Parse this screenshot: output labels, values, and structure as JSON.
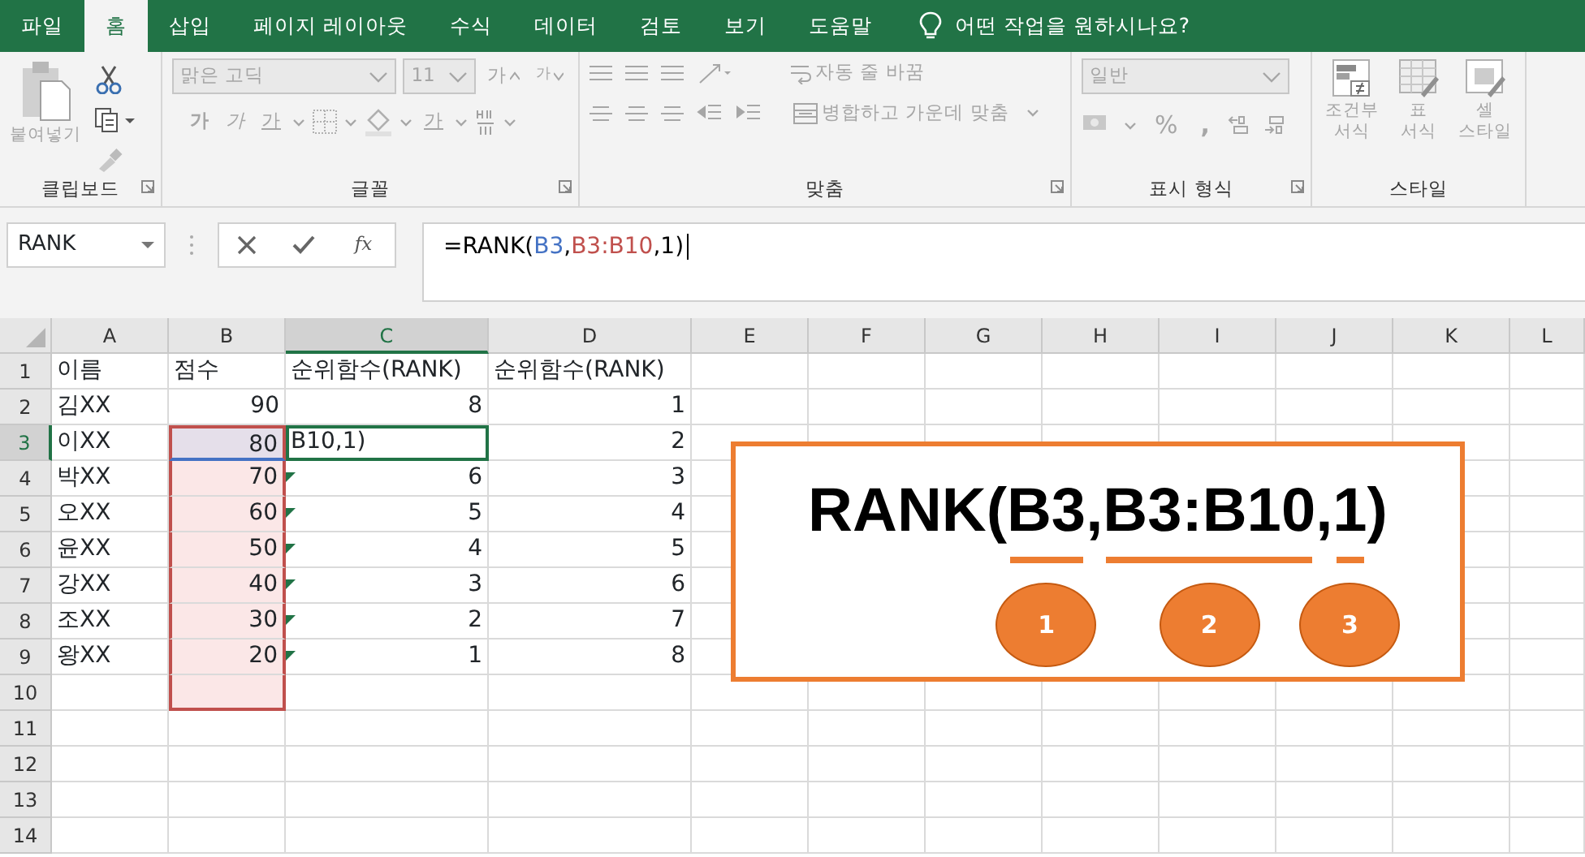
{
  "tabs": [
    {
      "label": "파일",
      "selected": false
    },
    {
      "label": "홈",
      "selected": true
    },
    {
      "label": "삽입",
      "selected": false
    },
    {
      "label": "페이지 레이아웃",
      "selected": false
    },
    {
      "label": "수식",
      "selected": false
    },
    {
      "label": "데이터",
      "selected": false
    },
    {
      "label": "검토",
      "selected": false
    },
    {
      "label": "보기",
      "selected": false
    },
    {
      "label": "도움말",
      "selected": false
    }
  ],
  "tell_me": "어떤 작업을 원하시나요?",
  "ribbon": {
    "clipboard": {
      "paste": "붙여넣기",
      "label": "클립보드"
    },
    "font": {
      "font_name": "맑은 고딕",
      "font_size": "11",
      "grow": "가",
      "shrink": "가",
      "bold": "가",
      "italic": "가",
      "underline": "가",
      "font_color": "가",
      "label": "글꼴"
    },
    "alignment": {
      "wrap_text": "자동 줄 바꿈",
      "merge": "병합하고 가운데 맞춤",
      "label": "맞춤"
    },
    "number": {
      "format": "일반",
      "percent": "%",
      "comma": ",",
      "label": "표시 형식"
    },
    "styles": {
      "buttons": [
        {
          "text": "조건부\n서식",
          "kind": "conditional"
        },
        {
          "text": "표\n서식",
          "kind": "table"
        },
        {
          "text": "셀\n스타일",
          "kind": "cell"
        }
      ],
      "label": "스타일"
    }
  },
  "formula_bar": {
    "name_box": "RANK",
    "function_label": "fx",
    "formula": [
      {
        "text": "=RANK(",
        "color": "#000000"
      },
      {
        "text": "B3",
        "color": "#4472c4",
        "separator": ","
      },
      {
        "text": "B3:B10",
        "color": "#c0504d",
        "separator": ","
      },
      {
        "text": "1)",
        "color": "#000000"
      }
    ]
  },
  "sheet": {
    "columns": [
      {
        "label": "A",
        "selected": false
      },
      {
        "label": "B",
        "selected": false
      },
      {
        "label": "C",
        "selected": true
      },
      {
        "label": "D",
        "selected": false
      },
      {
        "label": "E",
        "selected": false
      },
      {
        "label": "F",
        "selected": false
      },
      {
        "label": "G",
        "selected": false
      },
      {
        "label": "H",
        "selected": false
      },
      {
        "label": "I",
        "selected": false
      },
      {
        "label": "J",
        "selected": false
      },
      {
        "label": "K",
        "selected": false
      },
      {
        "label": "L",
        "selected": false
      }
    ],
    "rows": [
      {
        "num": "1",
        "kind": "header",
        "selected": false,
        "in_range": false,
        "ref_cell": false,
        "editing": false,
        "error_flag": false,
        "cells": [
          "이름",
          "점수",
          "순위함수(RANK)",
          "순위함수(RANK)"
        ]
      },
      {
        "num": "2",
        "kind": "data",
        "selected": false,
        "in_range": false,
        "ref_cell": false,
        "editing": false,
        "error_flag": false,
        "cells": [
          "김XX",
          "90",
          "8",
          "1"
        ]
      },
      {
        "num": "3",
        "kind": "data",
        "selected": true,
        "in_range": true,
        "ref_cell": true,
        "editing": true,
        "error_flag": false,
        "cells": [
          "이XX",
          "80",
          "B10,1)",
          "2"
        ]
      },
      {
        "num": "4",
        "kind": "data",
        "selected": false,
        "in_range": true,
        "ref_cell": false,
        "editing": false,
        "error_flag": true,
        "cells": [
          "박XX",
          "70",
          "6",
          "3"
        ]
      },
      {
        "num": "5",
        "kind": "data",
        "selected": false,
        "in_range": true,
        "ref_cell": false,
        "editing": false,
        "error_flag": true,
        "cells": [
          "오XX",
          "60",
          "5",
          "4"
        ]
      },
      {
        "num": "6",
        "kind": "data",
        "selected": false,
        "in_range": true,
        "ref_cell": false,
        "editing": false,
        "error_flag": true,
        "cells": [
          "윤XX",
          "50",
          "4",
          "5"
        ]
      },
      {
        "num": "7",
        "kind": "data",
        "selected": false,
        "in_range": true,
        "ref_cell": false,
        "editing": false,
        "error_flag": true,
        "cells": [
          "강XX",
          "40",
          "3",
          "6"
        ]
      },
      {
        "num": "8",
        "kind": "data",
        "selected": false,
        "in_range": true,
        "ref_cell": false,
        "editing": false,
        "error_flag": true,
        "cells": [
          "조XX",
          "30",
          "2",
          "7"
        ]
      },
      {
        "num": "9",
        "kind": "data",
        "selected": false,
        "in_range": true,
        "ref_cell": false,
        "editing": false,
        "error_flag": true,
        "cells": [
          "왕XX",
          "20",
          "1",
          "8"
        ]
      },
      {
        "num": "10",
        "selected": false,
        "in_range": true,
        "ref_cell": false,
        "editing": false,
        "error_flag": false,
        "cells": []
      },
      {
        "num": "11",
        "selected": false,
        "in_range": false,
        "ref_cell": false,
        "editing": false,
        "error_flag": false,
        "cells": []
      },
      {
        "num": "12",
        "selected": false,
        "in_range": false,
        "ref_cell": false,
        "editing": false,
        "error_flag": false,
        "cells": []
      },
      {
        "num": "13",
        "selected": false,
        "in_range": false,
        "ref_cell": false,
        "editing": false,
        "error_flag": false,
        "cells": []
      },
      {
        "num": "14",
        "selected": false,
        "in_range": false,
        "ref_cell": false,
        "editing": false,
        "error_flag": false,
        "cells": []
      }
    ]
  },
  "callout": {
    "segments": [
      {
        "text": "RANK("
      },
      {
        "text": "B3",
        "marker": "1"
      },
      {
        "text": ","
      },
      {
        "text": "B3:B10",
        "marker": "2"
      },
      {
        "text": ","
      },
      {
        "text": "1",
        "marker": "3"
      },
      {
        "text": ")"
      }
    ]
  }
}
